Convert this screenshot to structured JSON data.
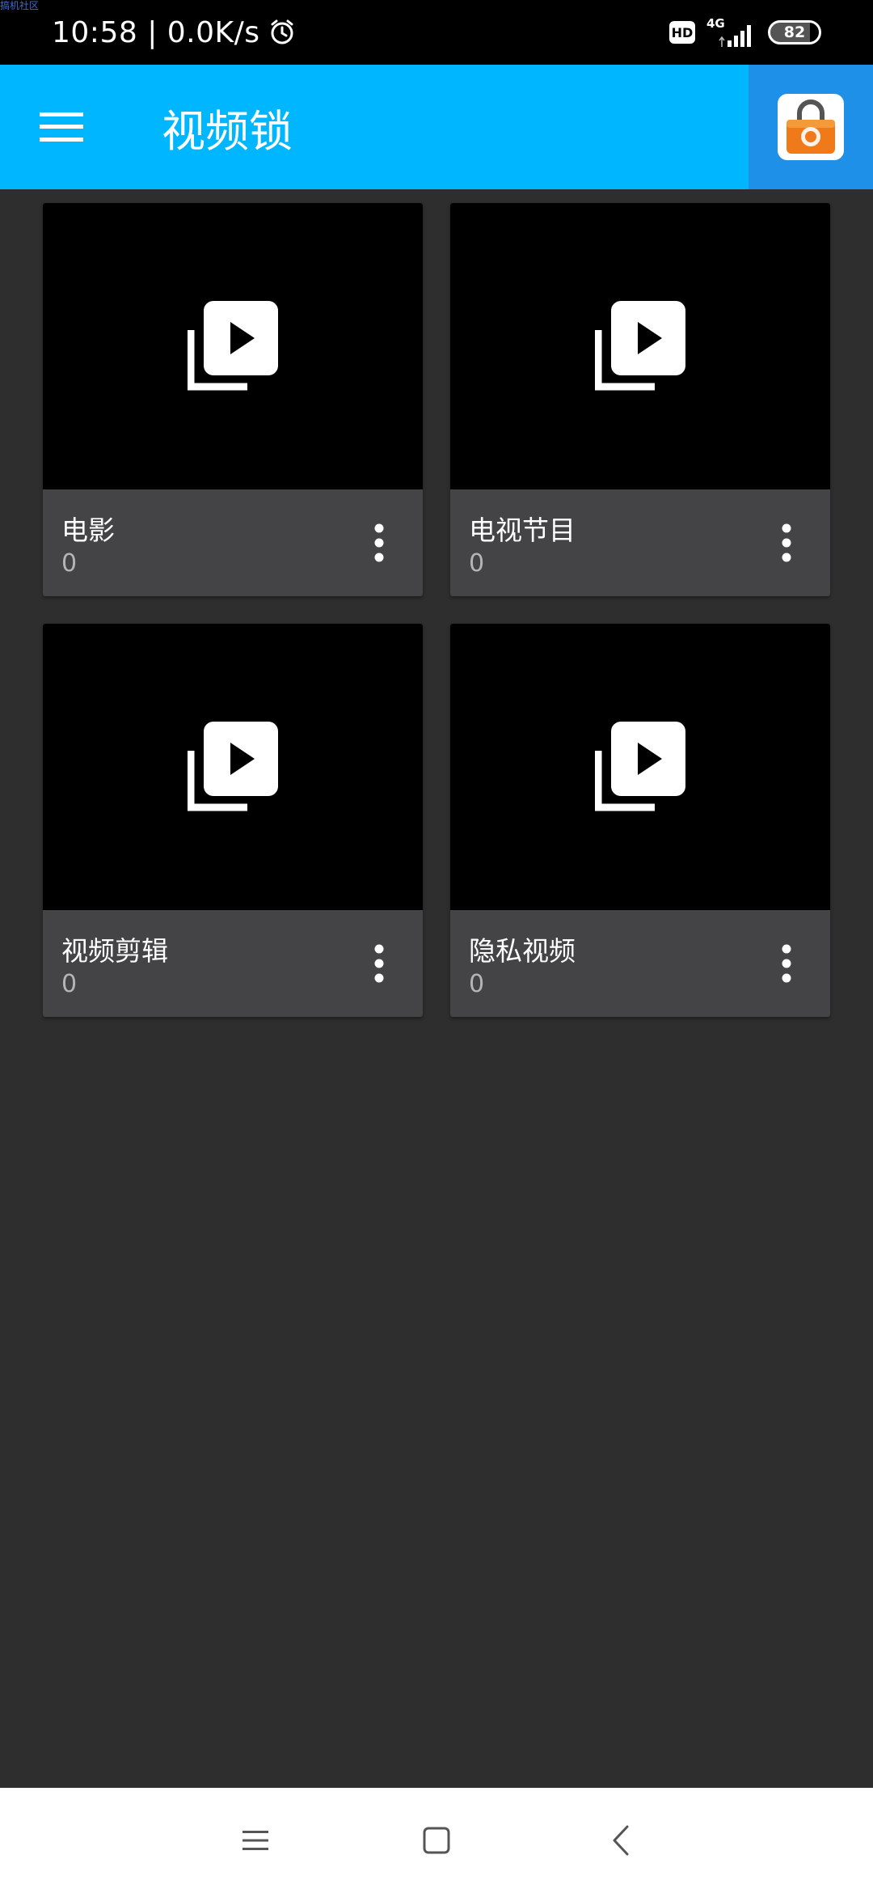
{
  "watermark": "搞机社区",
  "status_bar": {
    "time_speed": "10:58 | 0.0K/s",
    "hd_badge": "HD",
    "network_type": "4G",
    "battery": "82"
  },
  "app_bar": {
    "title": "视频锁"
  },
  "albums": [
    {
      "name": "电影",
      "count": "0"
    },
    {
      "name": "电视节目",
      "count": "0"
    },
    {
      "name": "视频剪辑",
      "count": "0"
    },
    {
      "name": "隐私视频",
      "count": "0"
    }
  ],
  "icons": {
    "menu": "hamburger-menu-icon",
    "lock": "camera-lock-icon",
    "album": "video-library-icon",
    "more": "more-vertical-icon",
    "nav_recents": "recents-icon",
    "nav_home": "home-icon",
    "nav_back": "back-icon"
  },
  "colors": {
    "app_bar": "#00b6ff",
    "lock_bg": "#1e90e8",
    "background": "#2e2e2e",
    "card": "#444446"
  }
}
